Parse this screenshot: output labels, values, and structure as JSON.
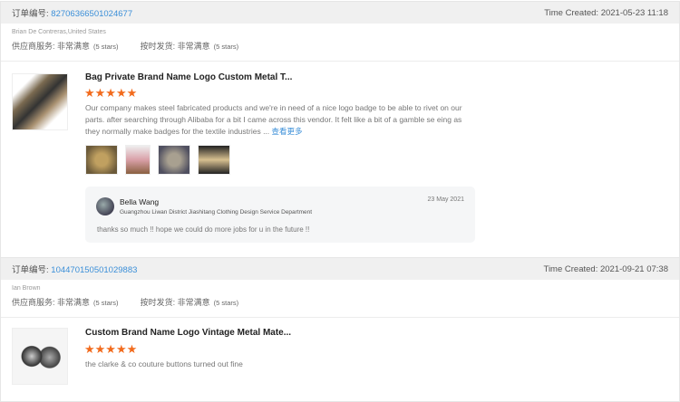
{
  "labels": {
    "order_no": "订单编号:",
    "time_created": "Time Created:",
    "supplier_service": "供应商服务:",
    "on_time": "按时发货:",
    "read_more": "查看更多"
  },
  "orders": [
    {
      "order_number": "82706366501024677",
      "time_created": "2021-05-23 11:18",
      "buyer": "Brian De Contreras,United States",
      "supplier_rating": "非常满意",
      "supplier_stars": "(5 stars)",
      "shipping_rating": "非常满意",
      "shipping_stars": "(5 stars)",
      "product_title": "Bag Private Brand Name Logo Custom Metal T...",
      "rating": "★★★★★",
      "review": "Our company makes steel fabricated products and we're in need of a nice logo badge to be able to rivet on our parts. after searching through Alibaba for a bit I came across this vendor. It felt like a bit of a gamble se eing as they normally make badges for the textile industries ...",
      "reply": {
        "name": "Bella Wang",
        "company": "Guangzhou Liwan District Jiashitang Clothing Design Service Department",
        "date": "23 May 2021",
        "message": "thanks so much !! hope we could do more jobs for u in the future !!"
      }
    },
    {
      "order_number": "104470150501029883",
      "time_created": "2021-09-21 07:38",
      "buyer": "Ian Brown",
      "supplier_rating": "非常满意",
      "supplier_stars": "(5 stars)",
      "shipping_rating": "非常满意",
      "shipping_stars": "(5 stars)",
      "product_title": "Custom Brand Name Logo Vintage Metal Mate...",
      "rating": "★★★★★",
      "review": "the clarke & co couture buttons turned out fine"
    }
  ]
}
